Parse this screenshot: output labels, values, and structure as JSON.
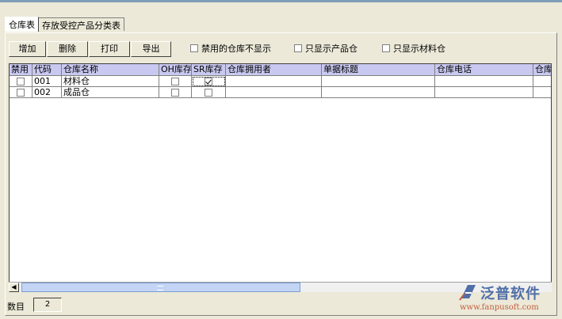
{
  "tabs": [
    {
      "label": "仓库表",
      "active": true
    },
    {
      "label": "存放受控产品分类表",
      "active": false
    }
  ],
  "toolbar": {
    "add_label": "增加",
    "delete_label": "删除",
    "print_label": "打印",
    "export_label": "导出"
  },
  "filters": [
    {
      "label": "禁用的仓库不显示",
      "checked": false
    },
    {
      "label": "只显示产品仓",
      "checked": false
    },
    {
      "label": "只显示材料仓",
      "checked": false
    }
  ],
  "grid": {
    "columns": [
      "禁用",
      "代码",
      "仓库名称",
      "OH库存",
      "SR库存",
      "仓库拥用者",
      "单据标题",
      "仓库电话",
      "仓库"
    ],
    "rows": [
      {
        "disabled": false,
        "code": "001",
        "name": "材料仓",
        "oh_stock": false,
        "sr_stock": true,
        "owner": "",
        "doc_title": "",
        "phone": ""
      },
      {
        "disabled": false,
        "code": "002",
        "name": "成品仓",
        "oh_stock": false,
        "sr_stock": false,
        "owner": "",
        "doc_title": "",
        "phone": ""
      }
    ]
  },
  "footer": {
    "count_label": "数目",
    "count_value": "2"
  },
  "logo": {
    "name": "泛普软件",
    "url": "www.fanpusoft.com"
  },
  "colors": {
    "header_bg": "#c8c8f0",
    "window_bg": "#ece9d8",
    "logo_blue": "#506ea8",
    "logo_url": "#c06040"
  }
}
